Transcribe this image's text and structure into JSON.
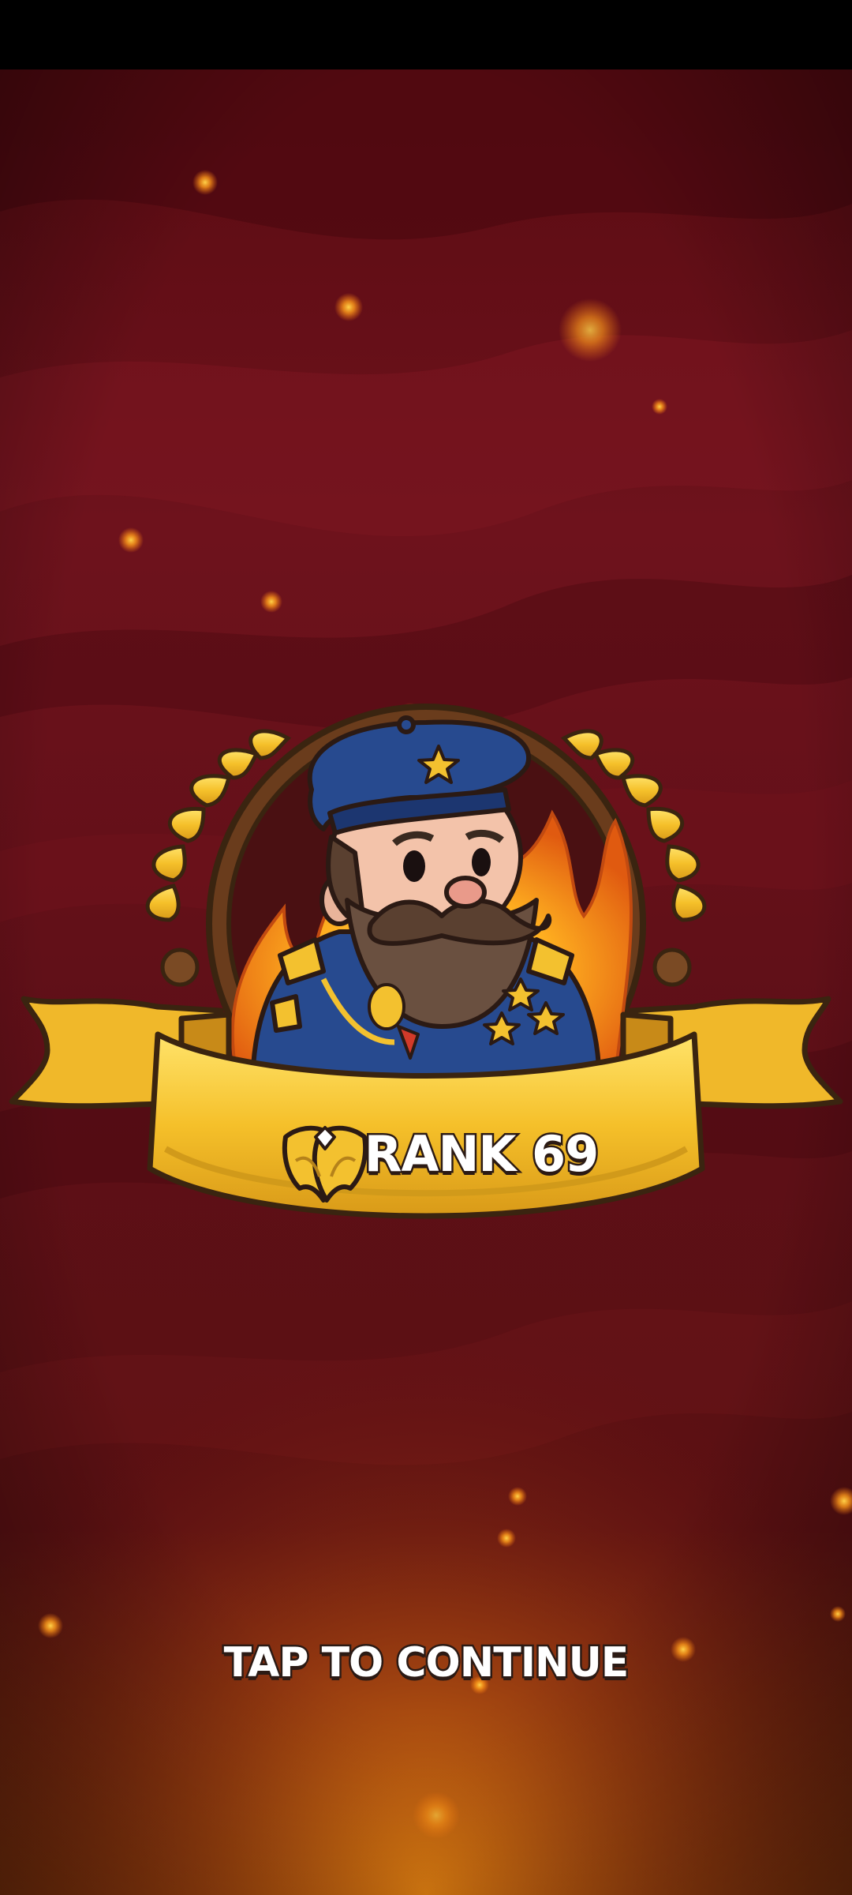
{
  "rank": {
    "label": "RANK 69",
    "icon": "winged-rank-insignia-icon"
  },
  "prompt": {
    "continue_label": "TAP TO CONTINUE"
  },
  "character": {
    "icon": "bearded-captain-portrait-icon"
  },
  "colors": {
    "background_dark": "#4a0a12",
    "background_mid": "#7a1420",
    "glow_orange": "#e07a1a",
    "gold": "#f3c12f",
    "gold_dark": "#b5821a",
    "outline": "#2b1a14",
    "uniform_blue": "#274a8f",
    "text": "#ffffff"
  }
}
